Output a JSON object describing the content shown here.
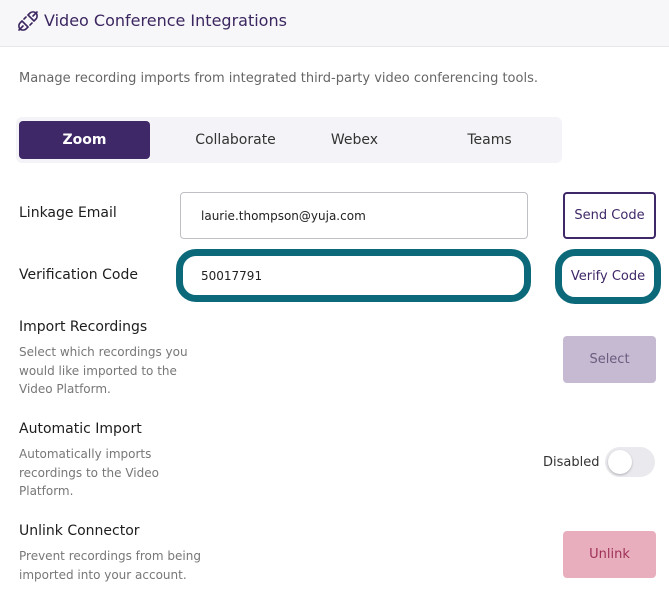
{
  "header": {
    "title": "Video Conference Integrations",
    "icon": "plug-icon"
  },
  "description": "Manage recording imports from integrated third-party video conferencing tools.",
  "tabs": [
    {
      "label": "Zoom",
      "active": true
    },
    {
      "label": "Collaborate",
      "active": false
    },
    {
      "label": "Webex",
      "active": false
    },
    {
      "label": "Teams",
      "active": false
    }
  ],
  "linkage": {
    "label": "Linkage Email",
    "value": "laurie.thompson@yuja.com",
    "button": "Send Code"
  },
  "verification": {
    "label": "Verification Code",
    "value": "50017791",
    "button": "Verify Code"
  },
  "import_recordings": {
    "label": "Import Recordings",
    "description": "Select which recordings you would like imported to the Video Platform.",
    "button": "Select"
  },
  "automatic_import": {
    "label": "Automatic Import",
    "description": "Automatically imports recordings to the Video Platform.",
    "status": "Disabled",
    "enabled": false
  },
  "unlink": {
    "label": "Unlink Connector",
    "description": "Prevent recordings from being imported into your account.",
    "button": "Unlink"
  },
  "colors": {
    "primary": "#3f2868",
    "highlight": "#0c6979",
    "select_bg": "#c6bad3",
    "unlink_bg": "#e8aebe"
  }
}
